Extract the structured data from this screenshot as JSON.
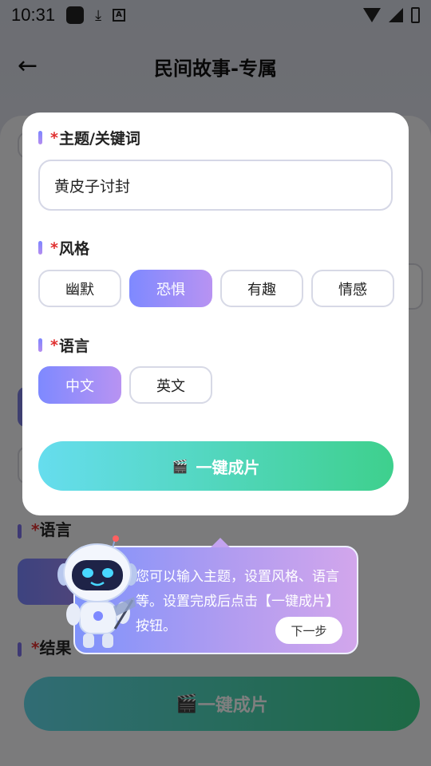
{
  "status_bar": {
    "time": "10:31"
  },
  "nav": {
    "title": "民间故事-专属"
  },
  "background": {
    "language_label": "语言",
    "result_label": "结果",
    "create_button": "一键成片"
  },
  "modal": {
    "topic": {
      "label": "主题/关键词",
      "value": "黄皮子讨封"
    },
    "style": {
      "label": "风格",
      "options": [
        "幽默",
        "恐惧",
        "有趣",
        "情感"
      ],
      "selected": "恐惧"
    },
    "language": {
      "label": "语言",
      "options": [
        "中文",
        "英文"
      ],
      "selected": "中文"
    },
    "create_button": "一键成片"
  },
  "tooltip": {
    "text": "您可以输入主题，设置风格、语言等。设置完成后点击【一键成片】按钮。",
    "next_button": "下一步"
  },
  "colors": {
    "accent_purple": "#7e89ff",
    "accent_violet": "#b893f2",
    "button_cyan": "#66ddee",
    "button_green": "#3ed08d",
    "required_star": "#e03030"
  }
}
